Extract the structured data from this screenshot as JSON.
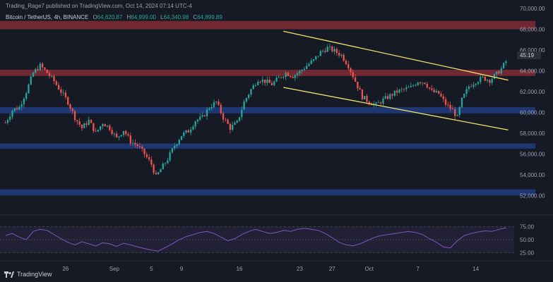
{
  "header": {
    "publisher_line": "Trading_Rage7 published on TradingView.com, Oct 14, 2024 07:14 UTC-4",
    "symbol": "Bitcoin / TetherUS, 4h, BINANCE",
    "ohlc": [
      {
        "label": "O",
        "value": "64,620.87"
      },
      {
        "label": "H",
        "value": "64,999.00"
      },
      {
        "label": "L",
        "value": "64,340.98"
      },
      {
        "label": "C",
        "value": "64,899.89"
      }
    ]
  },
  "price_axis": {
    "labels": [
      "70,000.00",
      "68,000.00",
      "66,000.00",
      "64,000.00",
      "62,000.00",
      "60,000.00",
      "58,000.00",
      "56,000.00",
      "54,000.00",
      "52,000.00"
    ],
    "countdown_badge": "45:19"
  },
  "rsi_axis": {
    "labels": [
      "75.00",
      "50.00",
      "25.00"
    ]
  },
  "time_axis": {
    "labels": [
      "26",
      "Sep",
      "5",
      "9",
      "16",
      "23",
      "27",
      "Oct",
      "7",
      "14"
    ]
  },
  "footer": {
    "brand": "TradingView"
  },
  "colors": {
    "background": "#161a25",
    "up": "#26a69a",
    "down": "#ef5350",
    "resistance_zone": "#7a2a35",
    "support_zone": "#1f3a7a",
    "channel": "#f2e36b",
    "rsi_line": "#7e57c2",
    "rsi_band": "#2a2540"
  },
  "chart_data": [
    {
      "type": "candlestick",
      "title": "Bitcoin / TetherUS, 4h, BINANCE",
      "ylim": [
        51000,
        70000
      ],
      "x_labels": [
        "26",
        "Sep",
        "5",
        "9",
        "16",
        "23",
        "27",
        "Oct",
        "7",
        "14"
      ],
      "close_path": [
        [
          0,
          59000
        ],
        [
          3,
          60200
        ],
        [
          6,
          60500
        ],
        [
          9,
          62000
        ],
        [
          12,
          63800
        ],
        [
          15,
          64500
        ],
        [
          18,
          63800
        ],
        [
          21,
          63000
        ],
        [
          24,
          62000
        ],
        [
          27,
          61000
        ],
        [
          30,
          59500
        ],
        [
          33,
          58500
        ],
        [
          36,
          59200
        ],
        [
          39,
          58000
        ],
        [
          42,
          59000
        ],
        [
          45,
          58500
        ],
        [
          48,
          57500
        ],
        [
          51,
          58300
        ],
        [
          54,
          57200
        ],
        [
          57,
          56800
        ],
        [
          60,
          56000
        ],
        [
          63,
          55000
        ],
        [
          65,
          53800
        ],
        [
          67,
          54500
        ],
        [
          70,
          55500
        ],
        [
          73,
          56800
        ],
        [
          76,
          57800
        ],
        [
          79,
          58200
        ],
        [
          82,
          59200
        ],
        [
          85,
          59500
        ],
        [
          88,
          60500
        ],
        [
          91,
          61000
        ],
        [
          94,
          59500
        ],
        [
          97,
          58500
        ],
        [
          100,
          59000
        ],
        [
          103,
          61000
        ],
        [
          106,
          62200
        ],
        [
          109,
          63200
        ],
        [
          112,
          63000
        ],
        [
          115,
          62700
        ],
        [
          118,
          63300
        ],
        [
          121,
          63800
        ],
        [
          124,
          63500
        ],
        [
          127,
          63900
        ],
        [
          130,
          64500
        ],
        [
          133,
          65000
        ],
        [
          136,
          65800
        ],
        [
          139,
          66200
        ],
        [
          142,
          65900
        ],
        [
          145,
          65500
        ],
        [
          148,
          64500
        ],
        [
          151,
          63000
        ],
        [
          154,
          61500
        ],
        [
          157,
          61000
        ],
        [
          160,
          60700
        ],
        [
          163,
          61200
        ],
        [
          166,
          61600
        ],
        [
          169,
          62000
        ],
        [
          172,
          62200
        ],
        [
          175,
          62400
        ],
        [
          178,
          63000
        ],
        [
          181,
          62900
        ],
        [
          184,
          62000
        ],
        [
          187,
          61800
        ],
        [
          190,
          60800
        ],
        [
          193,
          60200
        ],
        [
          195,
          59500
        ],
        [
          197,
          61200
        ],
        [
          200,
          62500
        ],
        [
          203,
          63000
        ],
        [
          206,
          63300
        ],
        [
          209,
          63100
        ],
        [
          212,
          63700
        ],
        [
          214,
          64200
        ],
        [
          216,
          64900
        ]
      ],
      "zones": [
        {
          "kind": "resistance",
          "from": 68000,
          "to": 68800
        },
        {
          "kind": "resistance",
          "from": 63500,
          "to": 64100
        },
        {
          "kind": "support",
          "from": 59900,
          "to": 60500
        },
        {
          "kind": "support",
          "from": 56500,
          "to": 57000
        },
        {
          "kind": "support",
          "from": 52000,
          "to": 52600
        }
      ],
      "trendlines": [
        {
          "name": "upper",
          "points": [
            [
              120,
              67800
            ],
            [
              217,
              63100
            ]
          ]
        },
        {
          "name": "lower",
          "points": [
            [
              120,
              62400
            ],
            [
              217,
              58300
            ]
          ]
        }
      ]
    },
    {
      "type": "line",
      "title": "RSI",
      "ylim": [
        20,
        80
      ],
      "reference_levels": [
        75,
        50,
        25
      ],
      "values": [
        58,
        62,
        55,
        50,
        66,
        70,
        68,
        60,
        52,
        45,
        40,
        46,
        42,
        38,
        44,
        42,
        37,
        43,
        40,
        36,
        33,
        30,
        28,
        35,
        42,
        50,
        56,
        60,
        64,
        66,
        62,
        55,
        48,
        52,
        60,
        66,
        70,
        66,
        62,
        64,
        68,
        66,
        70,
        72,
        70,
        68,
        62,
        54,
        45,
        40,
        38,
        42,
        48,
        54,
        58,
        60,
        62,
        64,
        66,
        64,
        60,
        52,
        45,
        36,
        34,
        48,
        58,
        62,
        65,
        67,
        66,
        70,
        73
      ]
    }
  ]
}
